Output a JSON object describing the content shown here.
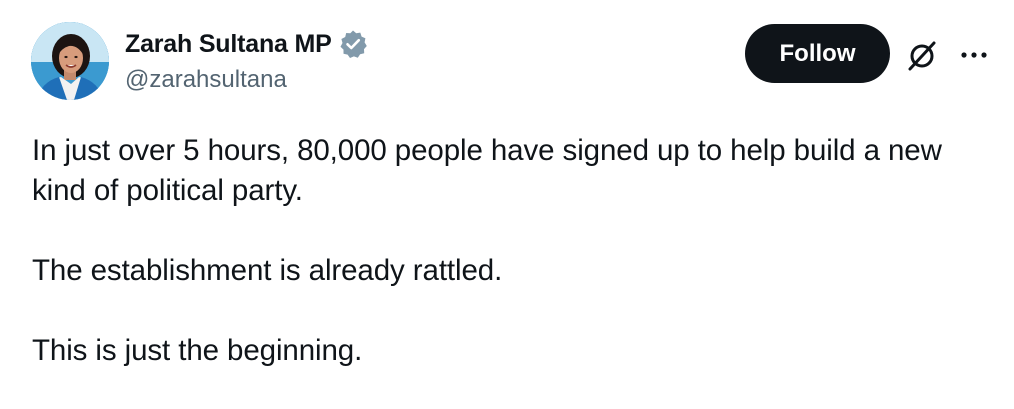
{
  "author": {
    "display_name": "Zarah Sultana MP",
    "handle": "@zarahsultana",
    "verified": true,
    "verified_color": "#829aab",
    "avatar_icon": "profile-photo"
  },
  "actions": {
    "follow_label": "Follow",
    "grok_icon": "slashed-circle-icon",
    "more_icon": "more-options-icon"
  },
  "tweet": {
    "paragraphs": [
      "In just over 5 hours, 80,000 people have signed up to help build a new kind of political party.",
      "The establishment is already rattled.",
      "This is just the beginning."
    ]
  }
}
